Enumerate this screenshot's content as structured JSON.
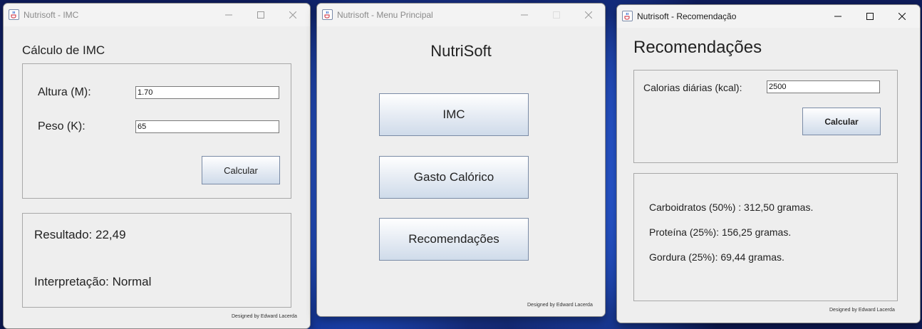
{
  "imc_window": {
    "title": "Nutrisoft - IMC",
    "heading": "Cálculo de IMC",
    "height_label": "Altura (M):",
    "height_value": "1.70",
    "weight_label": "Peso (K):",
    "weight_value": "65",
    "calculate_label": "Calcular",
    "result_text": "Resultado: 22,49",
    "interpretation_text": "Interpretação: Normal",
    "credit": "Designed by Edward Lacerda"
  },
  "menu_window": {
    "title": "Nutrisoft - Menu Principal",
    "heading": "NutriSoft",
    "imc_button": "IMC",
    "gasto_button": "Gasto Calórico",
    "recomendacoes_button": "Recomendações",
    "credit": "Designed by Edward Lacerda"
  },
  "rec_window": {
    "title": "Nutrisoft - Recomendação",
    "heading": "Recomendações",
    "calories_label": "Calorias diárias (kcal):",
    "calories_value": "2500",
    "calculate_label": "Calcular",
    "carbs_text": "Carboidratos (50%) : 312,50 gramas.",
    "protein_text": "Proteína (25%): 156,25 gramas.",
    "fat_text": "Gordura (25%): 69,44 gramas.",
    "credit": "Designed by Edward Lacerda"
  },
  "icons": {
    "app": "java-cup-icon",
    "minimize": "minimize-icon",
    "maximize": "maximize-icon",
    "close": "close-icon"
  },
  "colors": {
    "window_bg": "#eeeeee",
    "button_gradient_top": "#ffffff",
    "button_gradient_bottom": "#cfdbea",
    "wallpaper": "#2a5ad8"
  }
}
